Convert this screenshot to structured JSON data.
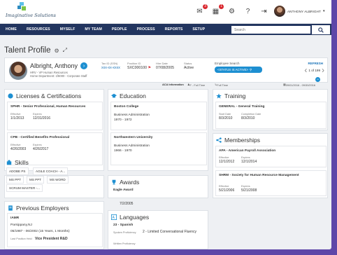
{
  "brand": {
    "name": "Imaginative Solutions",
    "colors": {
      "nav": "#22355f",
      "accent": "#1d8fd1",
      "frame": "#5e46a8"
    }
  },
  "topbar": {
    "icons": [
      {
        "name": "mail-icon",
        "glyph": "✉",
        "badge": "3"
      },
      {
        "name": "calendar-icon",
        "glyph": "▦",
        "badge": "1"
      },
      {
        "name": "settings-icon",
        "glyph": "⚙",
        "badge": ""
      },
      {
        "name": "help-icon",
        "glyph": "?",
        "badge": ""
      },
      {
        "name": "logout-icon",
        "glyph": "⇥",
        "badge": ""
      },
      {
        "name": "bell-icon",
        "glyph": "♪",
        "badge": ""
      }
    ],
    "user_name": "ANTHONY ALBRIGHT"
  },
  "nav": {
    "items": [
      "HOME",
      "RESOURCES",
      "MYSELF",
      "MY TEAM",
      "PEOPLE",
      "PROCESS",
      "REPORTS",
      "SETUP"
    ],
    "search_placeholder": "Search"
  },
  "page": {
    "title": "Talent Profile"
  },
  "employee": {
    "name": "Albright, Anthony",
    "role": "HRV - VP Human Resources",
    "department": "Home Department: 1f6000 - Corporate Staff",
    "tax_id_label": "Tax ID (SSN)",
    "tax_id": "xxx-xx-xxxx",
    "position_id_label": "Position ID",
    "position_id": "SXC000100",
    "hire_date_label": "Hire Date",
    "hire_date": "07/08/2005",
    "status_label": "Status",
    "status": "Active",
    "search_label": "Employee Search",
    "search_value": "<STATUS IS ACTIVE>",
    "refresh": "REFRESH",
    "pager": "1 of 199"
  },
  "aca": {
    "label": "ACA Information",
    "current": "F - Full Time",
    "next": "Full Time",
    "date_range": "09/01/2016 - 09/30/2016"
  },
  "licenses": {
    "title": "Licenses & Certifications",
    "items": [
      {
        "name": "SPHR - Senior Professional, Human Resources",
        "effective_label": "Effective",
        "effective": "1/1/2013",
        "expires_label": "Expires",
        "expires": "12/31/2016"
      },
      {
        "name": "CPB - Certified Benefits Professional",
        "effective_label": "Effective",
        "effective": "4/26/2003",
        "expires_label": "Expires",
        "expires": "4/26/2017"
      }
    ]
  },
  "skills": {
    "title": "Skills",
    "items": [
      "ADOBE PS",
      "AGILE COACH - A...",
      "MS PPT",
      "MS PPT",
      "MS WORD",
      "SCRUM MASTER -..."
    ]
  },
  "employers": {
    "title": "Previous Employers",
    "name": "IAMR",
    "location": "Parsippany,NJ",
    "period": "05/1987 - 06/2002  (15 Years, 1 Months)",
    "last_position_label": "Last Position Held",
    "last_position": "Vice President R&D"
  },
  "education": {
    "title": "Education",
    "items": [
      {
        "school": "Boston College",
        "degree": "Business Administration",
        "years": "1970 - 1972"
      },
      {
        "school": "Northwestern University",
        "degree": "Business Administration",
        "years": "1966 - 1970"
      }
    ]
  },
  "awards": {
    "title": "Awards",
    "name": "Eagle Award",
    "date": "7/2/2005"
  },
  "languages": {
    "title": "Languages",
    "name": "23 - Spanish",
    "spoken_label": "Spoken Proficiency",
    "spoken": "2 - Limited Conversational Fluency",
    "written_label": "Written Proficiency"
  },
  "training": {
    "title": "Training",
    "name": "GENERAL - General Training",
    "start_label": "Start Date",
    "start": "8/3/2010",
    "completion_label": "Completion Date",
    "completion": "8/3/2010"
  },
  "memberships": {
    "title": "Memberships",
    "items": [
      {
        "name": "APA - American Payroll Association",
        "effective_label": "Effective",
        "effective": "12/1/2012",
        "expires_label": "Expires",
        "expires": "12/1/2014"
      },
      {
        "name": "SHRM - Society for Human Resource Management",
        "effective_label": "Effective",
        "effective": "5/21/2006",
        "expires_label": "Expires",
        "expires": "5/21/2008"
      }
    ]
  }
}
